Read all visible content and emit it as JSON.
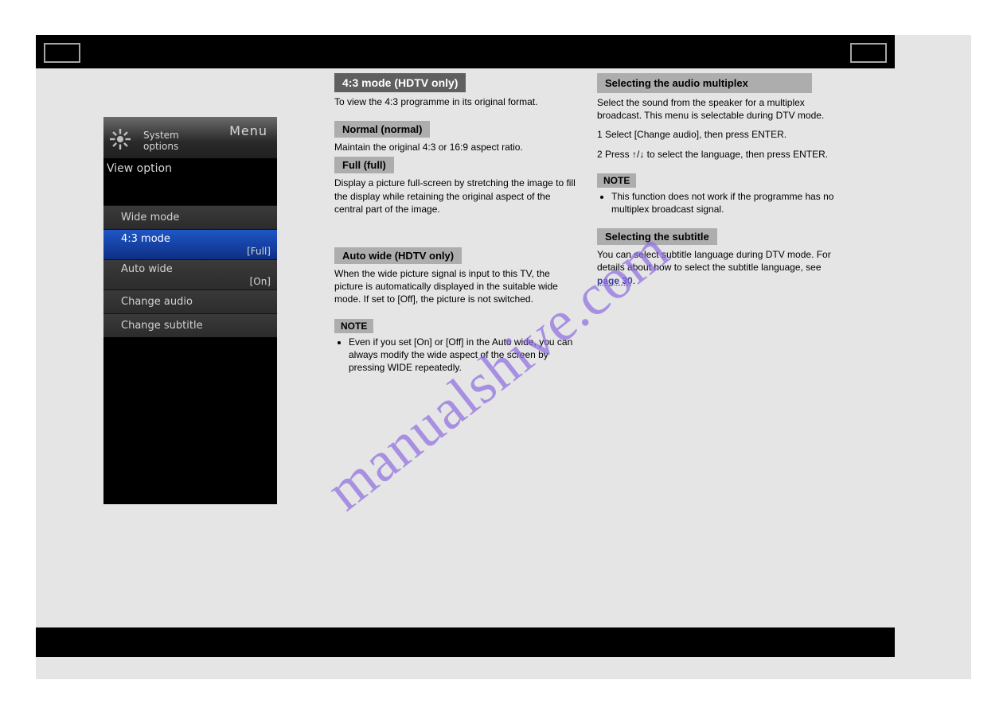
{
  "watermark": "manualshive.com",
  "tv": {
    "menu_label": "Menu",
    "header_line1": "System",
    "header_line2": "options",
    "section": "View option",
    "items": [
      {
        "label": "Wide mode",
        "value": "",
        "selected": false
      },
      {
        "label": "4:3 mode",
        "value": "[Full]",
        "selected": true
      },
      {
        "label": "Auto wide",
        "value": "[On]",
        "selected": false
      },
      {
        "label": "Change audio",
        "value": "",
        "selected": false
      },
      {
        "label": "Change subtitle",
        "value": "",
        "selected": false
      }
    ]
  },
  "colA": {
    "block0": {
      "title": "4:3 mode (HDTV only)",
      "para": "To view the 4:3 programme in its original format."
    },
    "block1": {
      "title": "Normal (normal)",
      "para": "Maintain the original 4:3 or 16:9 aspect ratio."
    },
    "block2": {
      "title": "Full (full)",
      "para": "Display a picture full-screen by stretching the image to fill the display while retaining the original aspect of the central part of the image."
    },
    "block3": {
      "title": "Auto wide (HDTV only)",
      "para": "When the wide picture signal is input to this TV, the picture is automatically displayed in the suitable wide mode. If set to [Off], the picture is not switched."
    },
    "note_label": "NOTE",
    "note_text": "Even if you set [On] or [Off] in the Auto wide, you can always modify the wide aspect of the screen by pressing WIDE repeatedly."
  },
  "colB": {
    "block0": {
      "title": "Selecting the audio multiplex",
      "para": "Select the sound from the speaker for a multiplex broadcast. This menu is selectable during DTV mode.",
      "step1": "1 Select [Change audio], then press ENTER.",
      "step2": "2 Press ↑/↓ to select the language, then press ENTER."
    },
    "note_label": "NOTE",
    "note_text": "This function does not work if the programme has no multiplex broadcast signal.",
    "block1": {
      "title": "Selecting the subtitle",
      "para": "You can select subtitle language during DTV mode. For details about how to select the subtitle language, see",
      "xref": "page 30"
    }
  }
}
